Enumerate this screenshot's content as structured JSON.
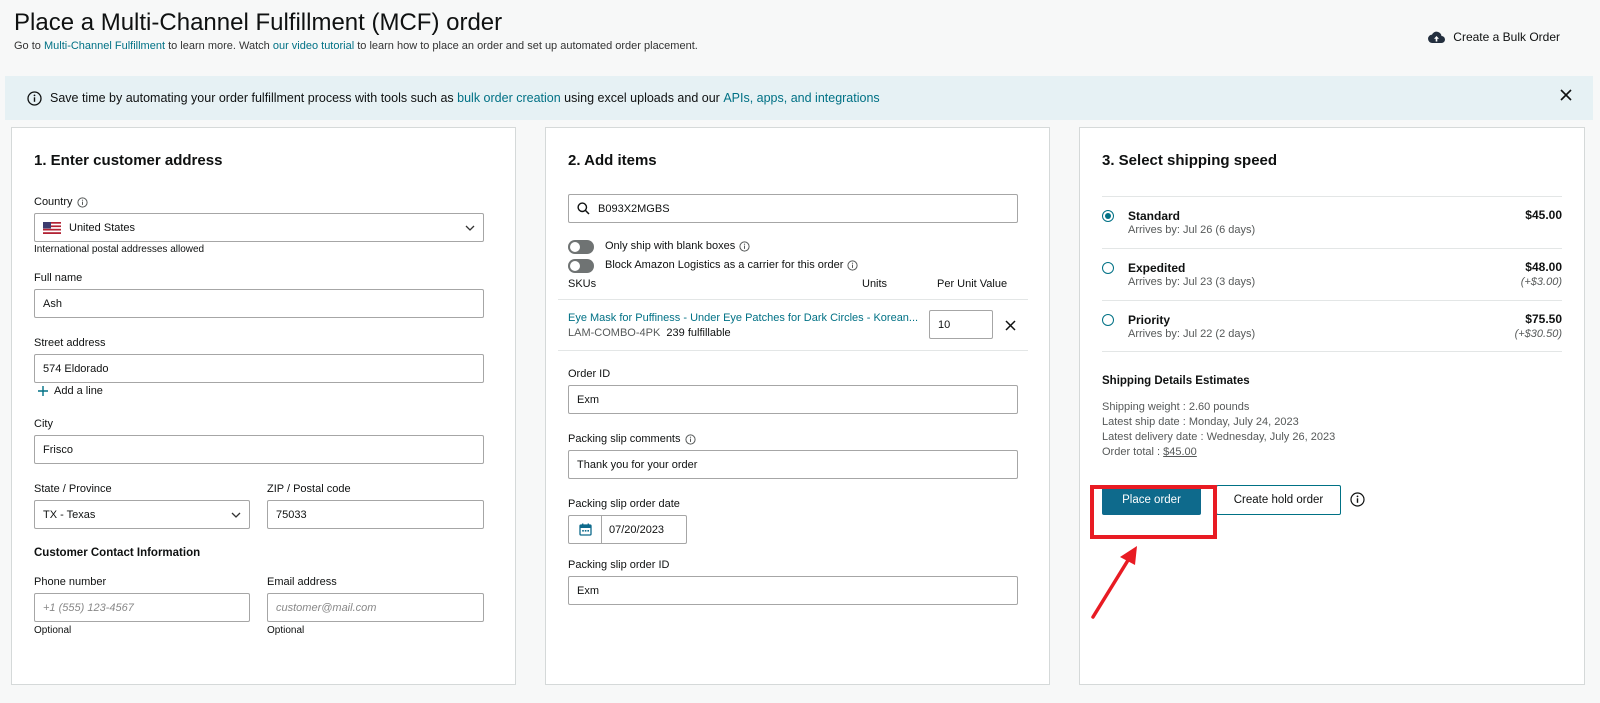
{
  "header": {
    "title": "Place a Multi-Channel Fulfillment (MCF) order",
    "subtitle_1": "Go to ",
    "subtitle_link1": "Multi-Channel Fulfillment",
    "subtitle_2": " to learn more. Watch ",
    "subtitle_link2": "our video tutorial",
    "subtitle_3": " to learn how to place an order and set up automated order placement.",
    "bulk_label": "Create a Bulk Order"
  },
  "banner": {
    "text_1": "Save time by automating your order fulfillment process with tools such as ",
    "link_1": "bulk order creation",
    "text_2": " using excel uploads and our ",
    "link_2": "APIs, apps, and integrations"
  },
  "address": {
    "title": "1. Enter customer address",
    "country_label": "Country",
    "country_value": "United States",
    "country_hint": "International postal addresses allowed",
    "name_label": "Full name",
    "name_value": "Ash",
    "street_label": "Street address",
    "street_value": "574 Eldorado",
    "add_line": "Add a line",
    "city_label": "City",
    "city_value": "Frisco",
    "state_label": "State / Province",
    "state_value": "TX - Texas",
    "zip_label": "ZIP / Postal code",
    "zip_value": "75033",
    "contact_title": "Customer Contact Information",
    "phone_label": "Phone number",
    "phone_placeholder": "+1 (555) 123-4567",
    "phone_hint": "Optional",
    "email_label": "Email address",
    "email_placeholder": "customer@mail.com",
    "email_hint": "Optional"
  },
  "items": {
    "title": "2. Add items",
    "search_value": "B093X2MGBS",
    "toggle_blank": "Only ship with blank boxes",
    "toggle_amazon": "Block Amazon Logistics as a carrier for this order",
    "col_skus": "SKUs",
    "col_units": "Units",
    "col_value": "Per Unit Value",
    "item_name": "Eye Mask for Puffiness - Under Eye Patches for Dark Circles - Korean...",
    "item_sku": "LAM-COMBO-4PK",
    "item_fulfillable": "239 fulfillable",
    "item_units": "10",
    "order_id_label": "Order ID",
    "order_id_value": "Exm",
    "comments_label": "Packing slip comments",
    "comments_value": "Thank you for your order",
    "date_label": "Packing slip order date",
    "date_value": "07/20/2023",
    "slip_id_label": "Packing slip order ID",
    "slip_id_value": "Exm"
  },
  "shipping": {
    "title": "3. Select shipping speed",
    "options": [
      {
        "name": "Standard",
        "arrives": "Arrives by: Jul 26 (6 days)",
        "price": "$45.00",
        "diff": ""
      },
      {
        "name": "Expedited",
        "arrives": "Arrives by: Jul 23 (3 days)",
        "price": "$48.00",
        "diff": "(+$3.00)"
      },
      {
        "name": "Priority",
        "arrives": "Arrives by: Jul 22 (2 days)",
        "price": "$75.50",
        "diff": "(+$30.50)"
      }
    ],
    "estimates_title": "Shipping Details Estimates",
    "weight_label": "Shipping weight : ",
    "weight_value": "2.60 pounds",
    "ship_date_label": "Latest ship date : ",
    "ship_date_value": "Monday, July 24, 2023",
    "delivery_label": "Latest delivery date : ",
    "delivery_value": "Wednesday, July 26, 2023",
    "total_label": "Order total : ",
    "total_value": "$45.00",
    "place_order": "Place order",
    "hold_order": "Create hold order"
  },
  "colors": {
    "primary": "#0e6a8c",
    "link": "#007185",
    "highlight": "#e81b23",
    "banner_bg": "#e6f1f4"
  }
}
